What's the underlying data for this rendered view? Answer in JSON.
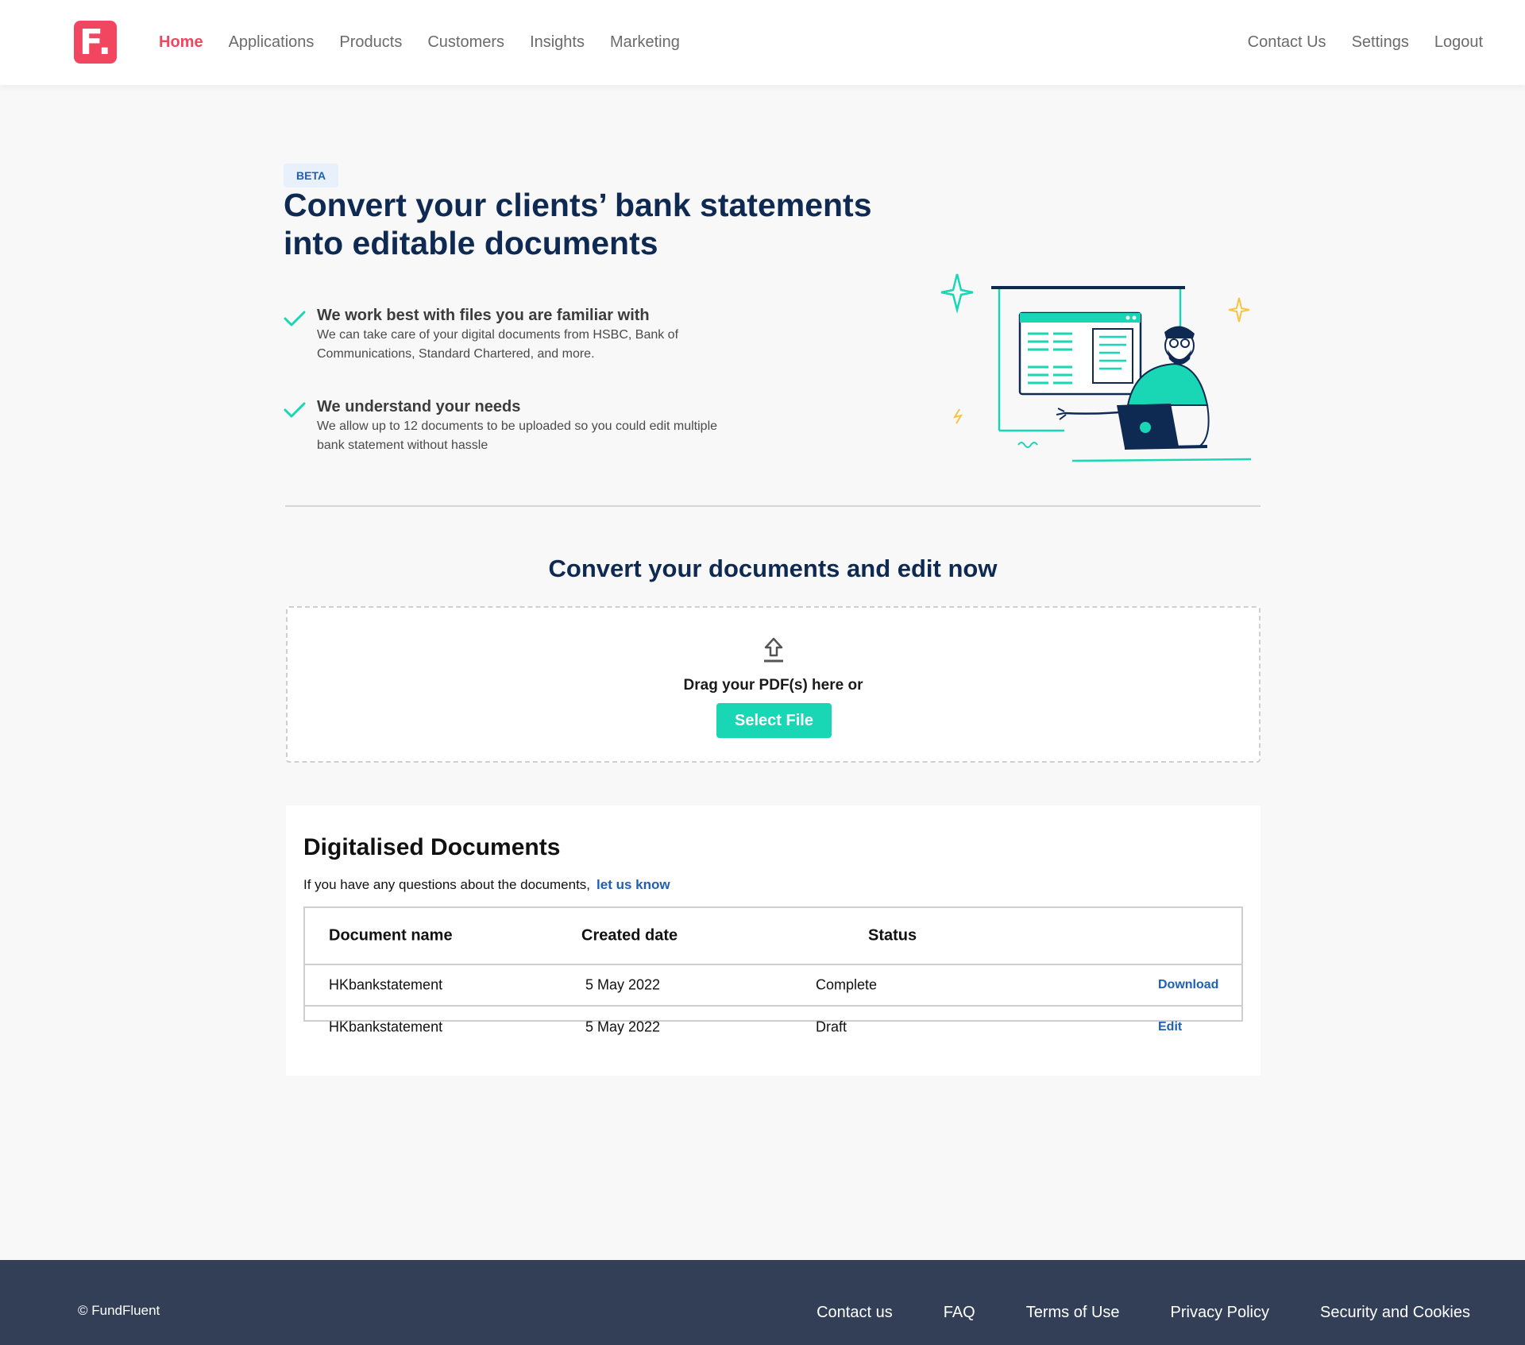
{
  "brand": {
    "logo_letter": "F.",
    "accent_color": "#f2455f"
  },
  "nav": {
    "left": [
      "Home",
      "Applications",
      "Products",
      "Customers",
      "Insights",
      "Marketing"
    ],
    "right": [
      "Contact Us",
      "Settings",
      "Logout"
    ],
    "active": "Home"
  },
  "hero": {
    "badge": "BETA",
    "title": "Convert your clients’ bank statements into editable documents",
    "features": [
      {
        "title": "We work best with files you are familiar with",
        "description": "We can take care of your digital documents from HSBC, Bank of Communications, Standard Chartered, and more."
      },
      {
        "title": "We understand your needs",
        "description": "We allow up to 12 documents to be uploaded so you could edit multiple bank statement without hassle"
      }
    ]
  },
  "upload": {
    "section_title": "Convert your documents and edit now",
    "drag_text": "Drag your PDF(s) here or",
    "button_label": "Select File",
    "button_color": "#19d6b4"
  },
  "documents": {
    "title": "Digitalised Documents",
    "help_text": "If you have any questions about the documents,",
    "help_link": "let us know",
    "columns": [
      "Document name",
      "Created date",
      "Status"
    ],
    "rows": [
      {
        "name": "HKbankstatement",
        "date": "5 May 2022",
        "status": "Complete",
        "action": "Download"
      },
      {
        "name": "HKbankstatement",
        "date": "5 May 2022",
        "status": "Draft",
        "action": "Edit"
      }
    ]
  },
  "footer": {
    "copyright": "© FundFluent",
    "links": [
      "Contact us",
      "FAQ",
      "Terms of Use",
      "Privacy Policy",
      "Security and Cookies"
    ]
  }
}
